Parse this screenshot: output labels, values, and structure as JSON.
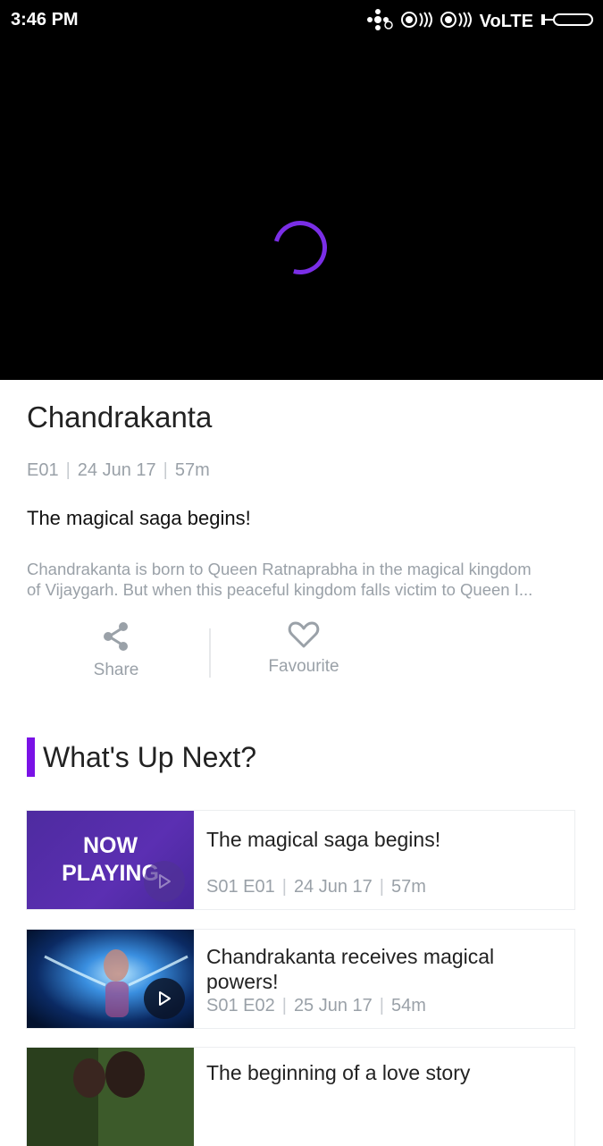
{
  "status_bar": {
    "time": "3:46 PM",
    "network": "VoLTE"
  },
  "show": {
    "title": "Chandrakanta",
    "meta": {
      "episode": "E01",
      "date": "24 Jun 17",
      "duration": "57m"
    },
    "episode_title": "The magical saga begins!",
    "description": [
      "Chandrakanta is born to Queen Ratnaprabha in the magical kingdom",
      "of Vijaygarh. But when this peaceful kingdom falls victim to Queen I..."
    ]
  },
  "actions": {
    "share": "Share",
    "favourite": "Favourite"
  },
  "up_next": {
    "heading": "What's Up Next?",
    "now_playing_label": [
      "NOW",
      "PLAYING"
    ],
    "items": [
      {
        "title": "The magical saga begins!",
        "episode": "S01 E01",
        "date": "24 Jun 17",
        "duration": "57m"
      },
      {
        "title": "Chandrakanta receives magical powers!",
        "episode": "S01 E02",
        "date": "25 Jun 17",
        "duration": "54m"
      },
      {
        "title": "The beginning of a love story"
      }
    ]
  },
  "colors": {
    "accent": "#7a12e6",
    "muted_text": "#9aa1a8"
  }
}
